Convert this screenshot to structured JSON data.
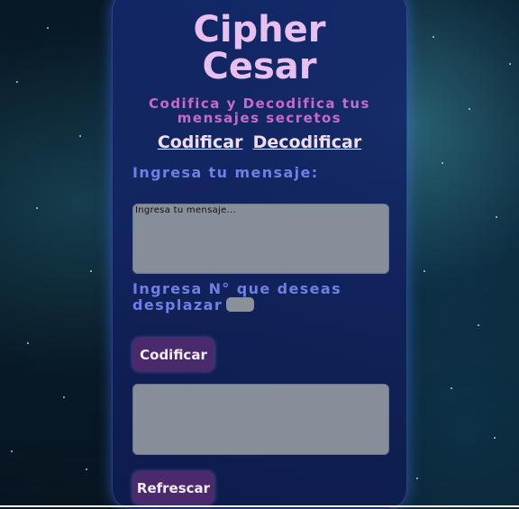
{
  "header": {
    "title_line1": "Cipher",
    "title_line2": "Cesar",
    "subtitle_line1": "Codifica y Decodifica tus",
    "subtitle_line2": "mensajes secretos"
  },
  "nav": {
    "encode_link": "Codificar",
    "decode_link": "Decodificar"
  },
  "form": {
    "message_label": "Ingresa tu mensaje:",
    "message_placeholder": "Ingresa tu mensaje...",
    "shift_label_line1": "Ingresa N° que deseas",
    "shift_label_line2": "desplazar",
    "shift_value": "",
    "encode_button": "Codificar",
    "output_value": "",
    "refresh_button": "Refrescar"
  },
  "colors": {
    "title": "#e8c0f0",
    "subtitle": "#c76bc9",
    "label": "#6f7fe6",
    "button_bg": "#4a2a6c",
    "card_bg": "#14286e"
  }
}
